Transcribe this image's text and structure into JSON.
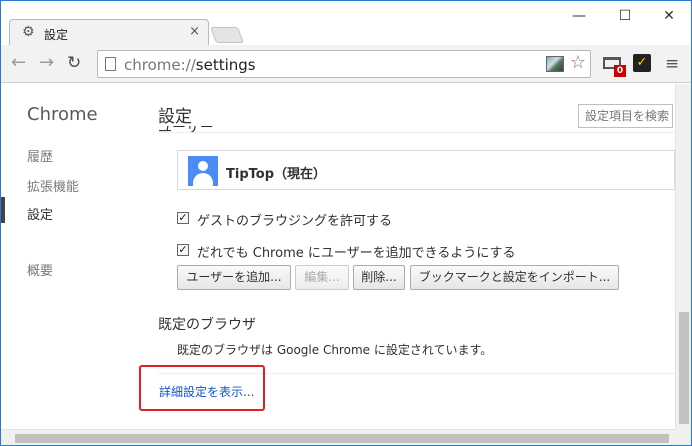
{
  "window": {
    "tab_title": "設定",
    "tab_close": "×",
    "min_glyph": "—",
    "max_glyph": "☐",
    "close_glyph": "✕"
  },
  "toolbar": {
    "back_glyph": "←",
    "forward_glyph": "→",
    "reload_glyph": "↻",
    "url_scheme": "chrome://",
    "url_host": "settings",
    "star_glyph": "☆",
    "ext_badge": "0",
    "ext2_glyph": "✓",
    "menu_glyph": "≡"
  },
  "sidebar": {
    "title": "Chrome",
    "items": [
      {
        "label": "履歴"
      },
      {
        "label": "拡張機能"
      },
      {
        "label": "設定"
      },
      {
        "label": "概要"
      }
    ],
    "active_index": 2
  },
  "main": {
    "title": "設定",
    "search_placeholder": "設定項目を検索",
    "clipped_section": "ユーザー",
    "user": {
      "name": "TipTop（現在）"
    },
    "checkboxes": [
      {
        "label": "ゲストのブラウジングを許可する",
        "checked": true
      },
      {
        "label": "だれでも Chrome にユーザーを追加できるようにする",
        "checked": true
      }
    ],
    "buttons": {
      "add_user": "ユーザーを追加...",
      "edit": "編集...",
      "delete": "削除...",
      "import": "ブックマークと設定をインポート..."
    },
    "default_browser": {
      "title": "既定のブラウザ",
      "text": "既定のブラウザは Google Chrome に設定されています。"
    },
    "advanced_link": "詳細設定を表示..."
  },
  "colors": {
    "accent": "#1155cc",
    "highlight": "#e02020",
    "avatar": "#4c8bf5"
  }
}
